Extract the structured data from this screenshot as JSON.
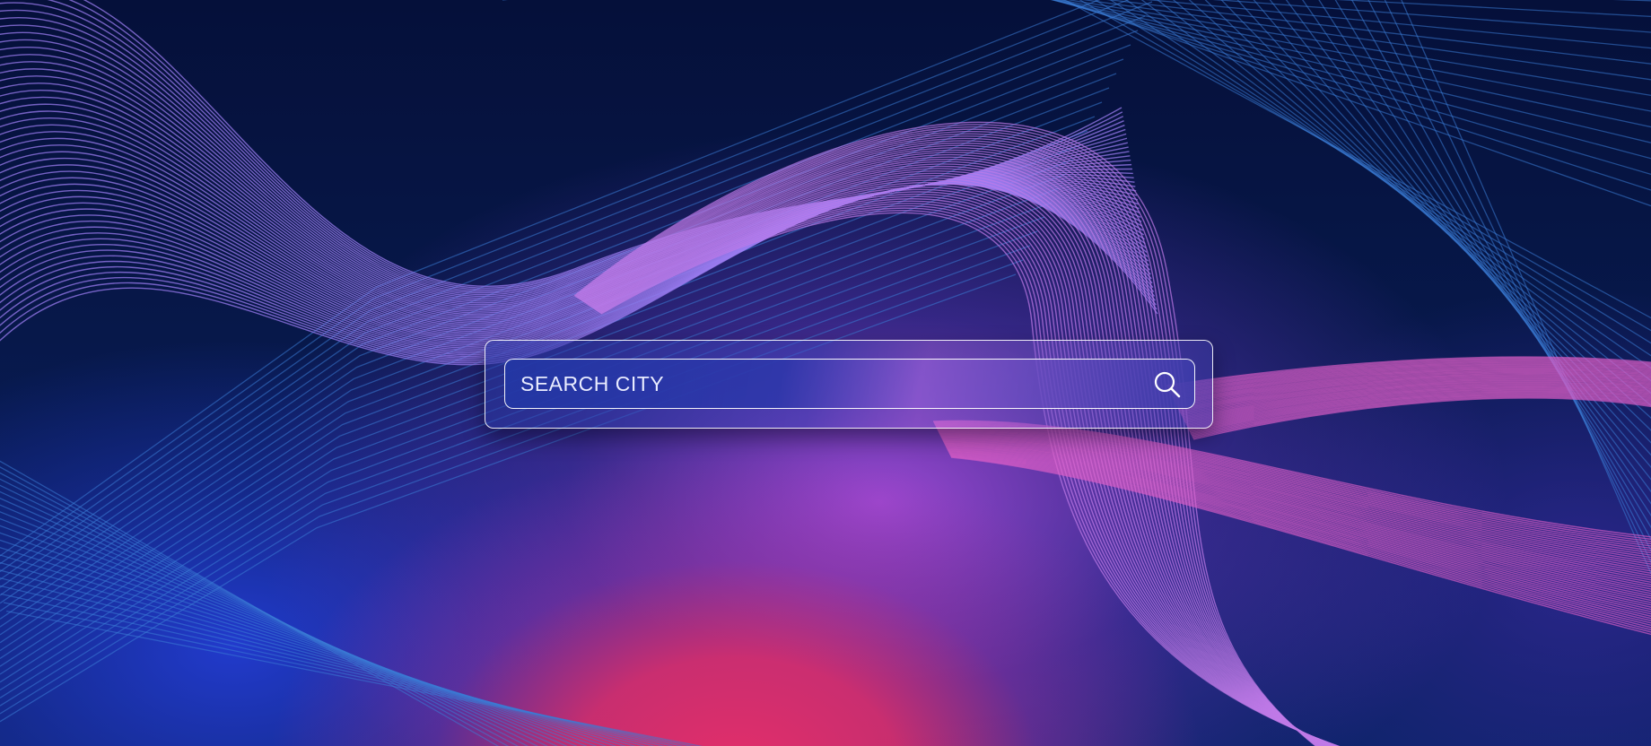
{
  "search": {
    "placeholder": "SEARCH CITY",
    "value": "",
    "icon": "search-icon"
  },
  "colors": {
    "background_dark": "#06123d",
    "accent_pink": "#e42e6a",
    "accent_purple": "#b050e6",
    "accent_blue": "#2340d2",
    "border": "#ffffff"
  }
}
